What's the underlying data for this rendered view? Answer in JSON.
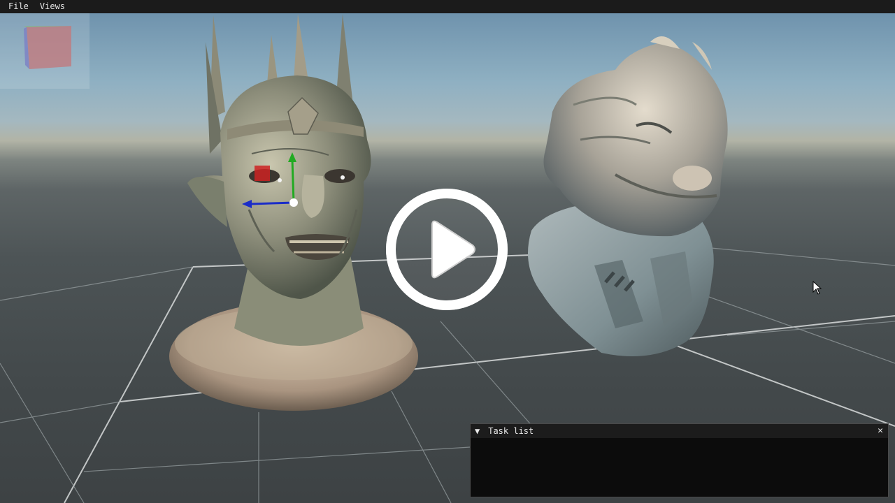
{
  "menu": {
    "file": "File",
    "views": "Views"
  },
  "task_panel": {
    "title": "Task list",
    "collapse_icon": "triangle-down-icon",
    "close_icon": "close-icon",
    "close_glyph": "✕",
    "arrow_glyph": "▼"
  },
  "viewport": {
    "objects": [
      "zombie-king-bust",
      "armored-lizard-bust"
    ],
    "gizmo": {
      "axes": [
        "x-axis-red",
        "y-axis-green",
        "z-axis-blue"
      ]
    },
    "overlay_icon": "play-icon"
  },
  "colors": {
    "menubar": "#1b1b1b",
    "panel": "#0c0c0c",
    "gizmo_red": "#cc2222",
    "gizmo_green": "#22aa22",
    "gizmo_blue": "#1a2cc8"
  }
}
